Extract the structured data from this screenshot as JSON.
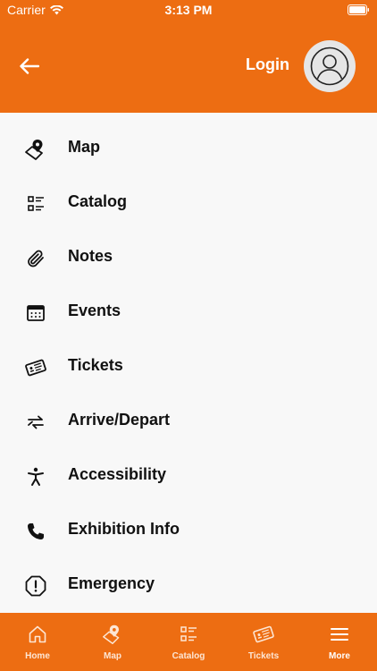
{
  "status_bar": {
    "carrier": "Carrier",
    "time": "3:13 PM"
  },
  "header": {
    "login_label": "Login"
  },
  "menu": {
    "items": [
      {
        "label": "Map",
        "icon": "map-pin-icon"
      },
      {
        "label": "Catalog",
        "icon": "list-icon"
      },
      {
        "label": "Notes",
        "icon": "paperclip-icon"
      },
      {
        "label": "Events",
        "icon": "calendar-icon"
      },
      {
        "label": "Tickets",
        "icon": "ticket-icon"
      },
      {
        "label": "Arrive/Depart",
        "icon": "arrows-icon"
      },
      {
        "label": "Accessibility",
        "icon": "accessibility-icon"
      },
      {
        "label": "Exhibition Info",
        "icon": "phone-icon"
      },
      {
        "label": "Emergency",
        "icon": "alert-octagon-icon"
      }
    ]
  },
  "tabbar": {
    "tabs": [
      {
        "label": "Home",
        "icon": "home-icon"
      },
      {
        "label": "Map",
        "icon": "map-pin-icon"
      },
      {
        "label": "Catalog",
        "icon": "list-icon"
      },
      {
        "label": "Tickets",
        "icon": "ticket-icon"
      },
      {
        "label": "More",
        "icon": "menu-icon",
        "active": true
      }
    ]
  },
  "colors": {
    "accent": "#ED6D12",
    "background": "#F8F8F8",
    "text": "#111111"
  }
}
